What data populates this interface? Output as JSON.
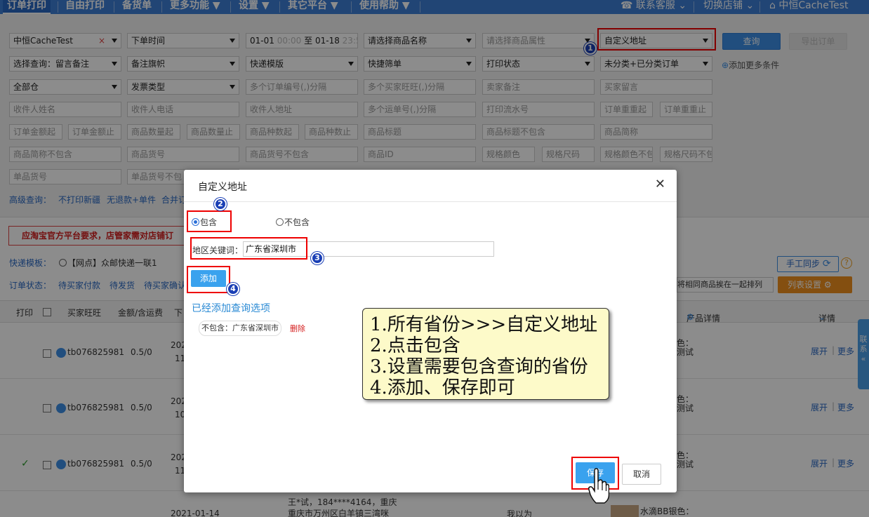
{
  "topnav": {
    "items": [
      "订单打印",
      "自由打印",
      "备货单",
      "更多功能 ▼",
      "设置 ▼",
      "其它平台 ▼",
      "使用帮助 ▼"
    ],
    "contact": "联系客服",
    "switch_shop": "切换店铺",
    "user": "中恒CacheTest"
  },
  "filters": {
    "row1": {
      "shop": "中恒CacheTest",
      "shop_clear": "×",
      "time_type": "下单时间",
      "date_from": "01-01",
      "time_from": "00:00",
      "date_sep": "至",
      "date_to": "01-18",
      "time_to": "23:59",
      "product_name": "请选择商品名称",
      "product_attr": "请选择商品属性",
      "custom_address": "自定义地址",
      "query_btn": "查询",
      "export_btn": "导出订单"
    },
    "row2": [
      "选择查询：留言备注",
      "备注旗帜",
      "快递模版",
      "快捷筛单",
      "打印状态",
      "未分类+已分类订单"
    ],
    "add_more": "添加更多条件",
    "row3": [
      "全部仓",
      "发票类型",
      "多个订单编号(,)分隔",
      "多个买家旺旺(,)分隔",
      "卖家备注",
      "买家留言"
    ],
    "row4": [
      "收件人姓名",
      "收件人电话",
      "收件人地址",
      "多个运单号(,)分隔",
      "打印流水号",
      "订单重重起",
      "订单重重止"
    ],
    "row5": [
      "订单金额起",
      "订单金额止",
      "商品数量起",
      "商品数量止",
      "商品种数起",
      "商品种数止",
      "商品标题",
      "商品标题不包含",
      "商品简称"
    ],
    "row6": [
      "商品简称不包含",
      "商品货号",
      "商品货号不包含",
      "商品ID",
      "规格颜色",
      "规格尺码",
      "规格颜色不包",
      "规格尺码不包"
    ],
    "row7": [
      "单品货号",
      "单品货号不包"
    ]
  },
  "advanced": {
    "label": "高级查询：",
    "links": [
      "不打印新疆",
      "无退款+单件",
      "合并订"
    ]
  },
  "warning": "应淘宝官方平台要求，店管家需对店铺订",
  "express": {
    "label": "快递模板：",
    "option": "【网点】众邮快递一联1"
  },
  "order_status": {
    "label": "订单状态：",
    "links": [
      "待买家付款",
      "待发货",
      "待买家确认"
    ]
  },
  "right_tools": {
    "sync": "手工同步",
    "group": "将相同商品挨在一起排列",
    "list_settings": "列表设置"
  },
  "table": {
    "headers": [
      "打印",
      "买家旺旺",
      "金额/含运费",
      "下",
      "产品详情",
      "详情"
    ],
    "rows": [
      {
        "buyer": "tb076825981",
        "amount": "0.5/0",
        "date": "202",
        "date2": "11",
        "attr": "色：",
        "title": "测试",
        "expand": "展开",
        "more": "更多",
        "printed": ""
      },
      {
        "buyer": "tb076825981",
        "amount": "0.5/0",
        "date": "202",
        "date2": "10",
        "attr": "色：",
        "title": "测试",
        "expand": "展开",
        "more": "更多",
        "printed": ""
      },
      {
        "buyer": "tb076825981",
        "amount": "0.5/0",
        "date": "202",
        "date2": "11",
        "attr": "色：",
        "title": "测试",
        "expand": "展开",
        "more": "更多",
        "printed": "✓"
      }
    ],
    "partial_row": {
      "addr1": "王*试，184****4164，重庆",
      "addr2": "重庆市万州区白羊镇三湾咪",
      "date": "2021-01-14",
      "note": "我以为",
      "product": "水滴BB银色："
    }
  },
  "side_tab": "联系",
  "dialog": {
    "title": "自定义地址",
    "include": "包含",
    "exclude": "不包含",
    "keyword_label": "地区关键词：",
    "keyword_value": "广东省深圳市",
    "add_btn": "添加",
    "added_title": "已经添加查询选项",
    "added_item": "不包含：广东省深圳市",
    "delete": "删除",
    "save": "保存",
    "cancel": "取消"
  },
  "steps": [
    "1",
    "2",
    "3",
    "4"
  ],
  "tip": [
    "1.所有省份>>>自定义地址",
    "2.点击包含",
    "3.设置需要包含查询的省份",
    "4.添加、保存即可"
  ]
}
